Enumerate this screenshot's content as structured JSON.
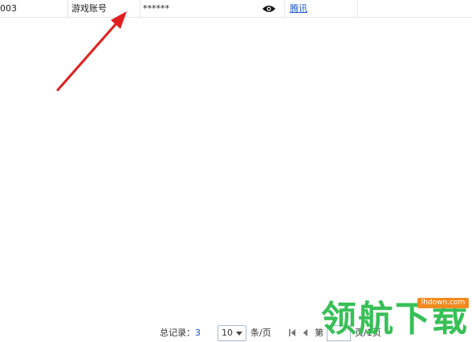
{
  "row": {
    "id": "003",
    "type": "游戏账号",
    "password_masked": "******",
    "platform": "腾讯"
  },
  "pager": {
    "total_label": "总记录：",
    "total_count": "3",
    "page_size": "10",
    "per_page_label": "条/页",
    "page_prefix": "第",
    "page_suffix": "页/1页"
  },
  "watermark": {
    "text": "领航下载",
    "url": "lhdown.com"
  },
  "colors": {
    "arrow": "#e02020",
    "link": "#1a55c8",
    "watermark_green": "#2dbd4f",
    "watermark_orange": "#f28a1f"
  }
}
